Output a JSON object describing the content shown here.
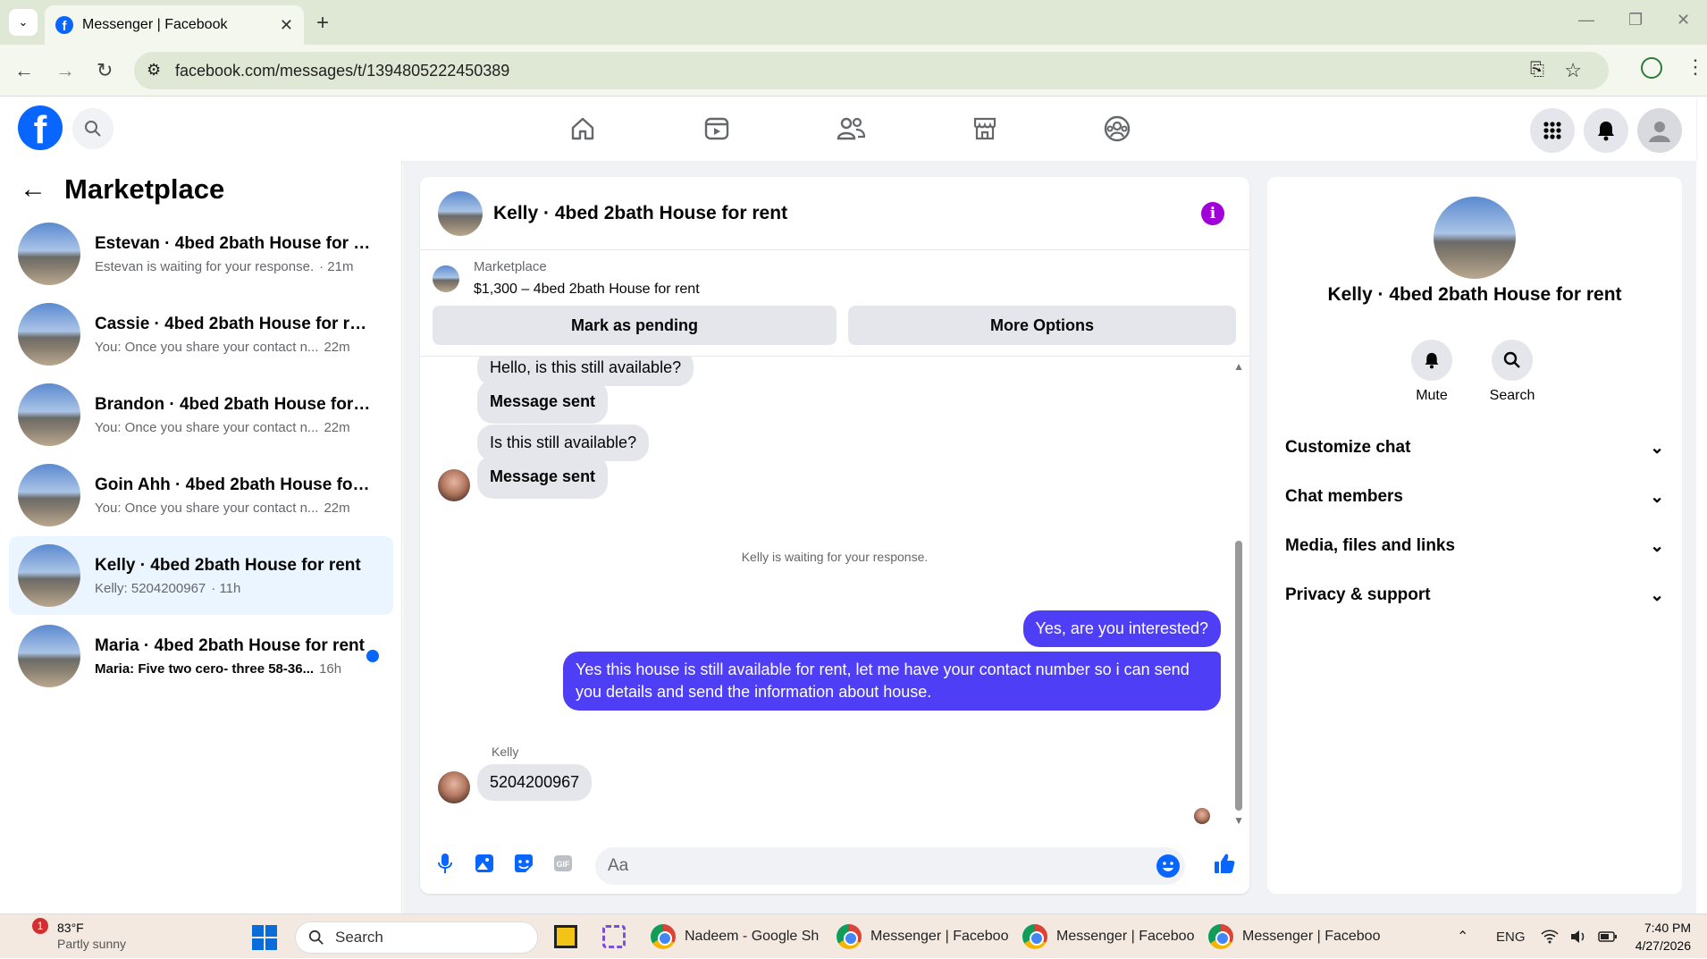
{
  "browser": {
    "tab_title": "Messenger | Facebook",
    "url": "facebook.com/messages/t/1394805222450389"
  },
  "sidebar": {
    "title": "Marketplace",
    "conversations": [
      {
        "name": "Estevan · 4bed 2bath House for rent",
        "preview": "Estevan is waiting for your response.",
        "time": "· 21m"
      },
      {
        "name": "Cassie · 4bed 2bath House for rent",
        "preview": "You: Once you share your contact n...",
        "time": "22m"
      },
      {
        "name": "Brandon · 4bed 2bath House for r...",
        "preview": "You: Once you share your contact n...",
        "time": "22m"
      },
      {
        "name": "Goin Ahh · 4bed 2bath House for r...",
        "preview": "You: Once you share your contact n...",
        "time": "22m"
      },
      {
        "name": "Kelly · 4bed 2bath House for rent",
        "preview": "Kelly: 5204200967",
        "time": "· 11h"
      },
      {
        "name": "Maria · 4bed 2bath House for rent",
        "preview": "Maria: Five two cero- three 58-36...",
        "time": "16h"
      }
    ]
  },
  "chat": {
    "title": "Kelly · 4bed 2bath House for rent",
    "marketplace_label": "Marketplace",
    "listing": "$1,300 – 4bed 2bath House for rent",
    "mark_pending": "Mark as pending",
    "more_options": "More Options",
    "messages": {
      "m1": "Hello, is this still available?",
      "m2": "Message sent",
      "m3": "Is this still available?",
      "m4": "Message sent",
      "system": "Kelly is waiting for your response.",
      "out1": "Yes, are you interested?",
      "out2": "Yes this house is still available for rent, let me have your contact number so i can send you details and send the information about house.",
      "sender": "Kelly",
      "in1": "5204200967"
    },
    "input_placeholder": "Aa"
  },
  "info": {
    "name": "Kelly · 4bed 2bath House for rent",
    "mute": "Mute",
    "search": "Search",
    "sections": [
      "Customize chat",
      "Chat members",
      "Media, files and links",
      "Privacy & support"
    ]
  },
  "taskbar": {
    "temp": "83°F",
    "weather": "Partly sunny",
    "weather_badge": "1",
    "search": "Search",
    "apps": [
      "Nadeem - Google Sh",
      "Messenger | Faceboo",
      "Messenger | Faceboo",
      "Messenger | Faceboo"
    ],
    "lang": "ENG",
    "time": "7:40 PM",
    "date": "4/27/2026"
  }
}
